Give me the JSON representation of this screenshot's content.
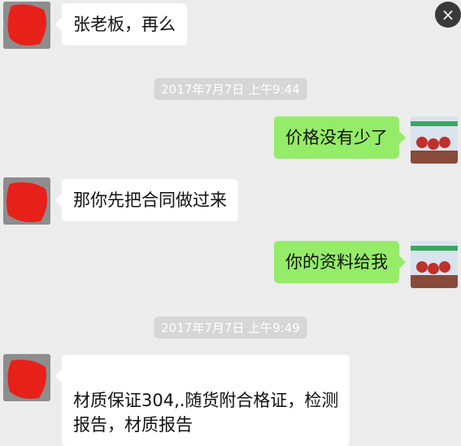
{
  "colors": {
    "background": "#ececec",
    "bubble_in": "#ffffff",
    "bubble_out": "#95ec69",
    "time_pill": "#d6d6d6",
    "redaction": "#e8201a"
  },
  "close_icon": "×",
  "messages": [
    {
      "text": "张老板，再么"
    },
    {
      "time": "2017年7月7日 上午9:44"
    },
    {
      "text": "价格没有少了"
    },
    {
      "text": "那你先把合同做过来"
    },
    {
      "text": "你的资料给我"
    },
    {
      "time": "2017年7月7日 上午9:49"
    },
    {
      "text": "材质保证304,.随货附合格证，检测\n报告，材质报告"
    }
  ]
}
